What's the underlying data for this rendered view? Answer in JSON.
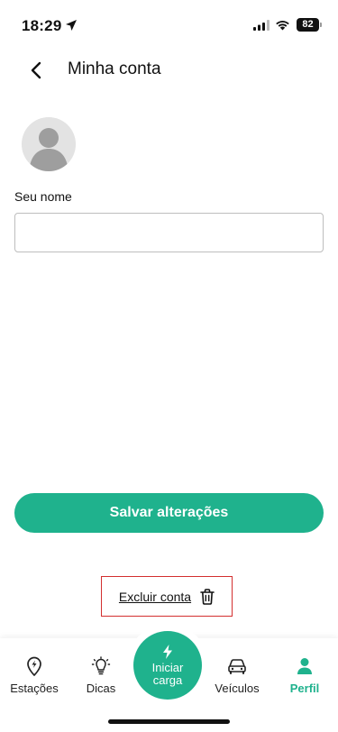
{
  "status_bar": {
    "time": "18:29",
    "battery": "82"
  },
  "header": {
    "title": "Minha conta"
  },
  "form": {
    "name_label": "Seu nome",
    "name_value": ""
  },
  "actions": {
    "save_label": "Salvar alterações",
    "delete_label": "Excluir conta"
  },
  "nav": {
    "items": [
      {
        "label": "Estações",
        "icon": "ev-station-pin-icon"
      },
      {
        "label": "Dicas",
        "icon": "lightbulb-icon"
      },
      {
        "label": "Veículos",
        "icon": "car-icon"
      },
      {
        "label": "Perfil",
        "icon": "person-icon",
        "active": true
      }
    ],
    "fab": {
      "line1": "Iniciar",
      "line2": "carga",
      "icon": "bolt-icon"
    }
  },
  "colors": {
    "accent": "#1fb28d",
    "highlight_border": "#d32f2f"
  }
}
